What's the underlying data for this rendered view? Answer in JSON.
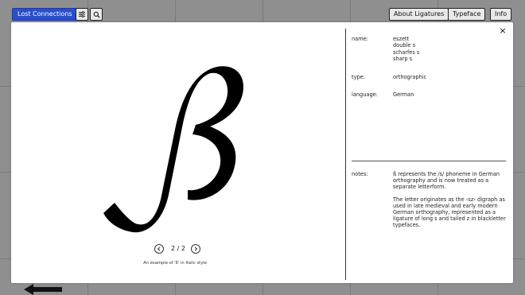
{
  "topbar": {
    "brand_label": "Lost Connections",
    "filter_icon": "sliders-icon",
    "search_icon": "search-icon",
    "nav": [
      "About Ligatures",
      "Typeface",
      "Info"
    ]
  },
  "modal": {
    "close_label": "×",
    "glyph": "ß",
    "pager": {
      "current_total": "2 / 2"
    },
    "caption": "An example of 'ß' in Italic style",
    "info": {
      "name_label": "name:",
      "name_values": [
        "eszett",
        "double s",
        "scharfes s",
        "sharp s"
      ],
      "type_label": "type:",
      "type_value": "orthographic",
      "language_label": "language:",
      "language_value": "German",
      "notes_label": "notes:",
      "notes_paragraphs": [
        "ß represents the /s/ phoneme in German orthography and is now treated as a separate letterform.",
        "The letter originates as the ‹sz› digraph as used in late medieval and early modern German orthography, represented as a ligature of long s and tailed z in blackletter typefaces."
      ]
    }
  },
  "colors": {
    "background": "#8f8f8f",
    "brand": "#2b4fc9",
    "modal": "#ffffff"
  }
}
